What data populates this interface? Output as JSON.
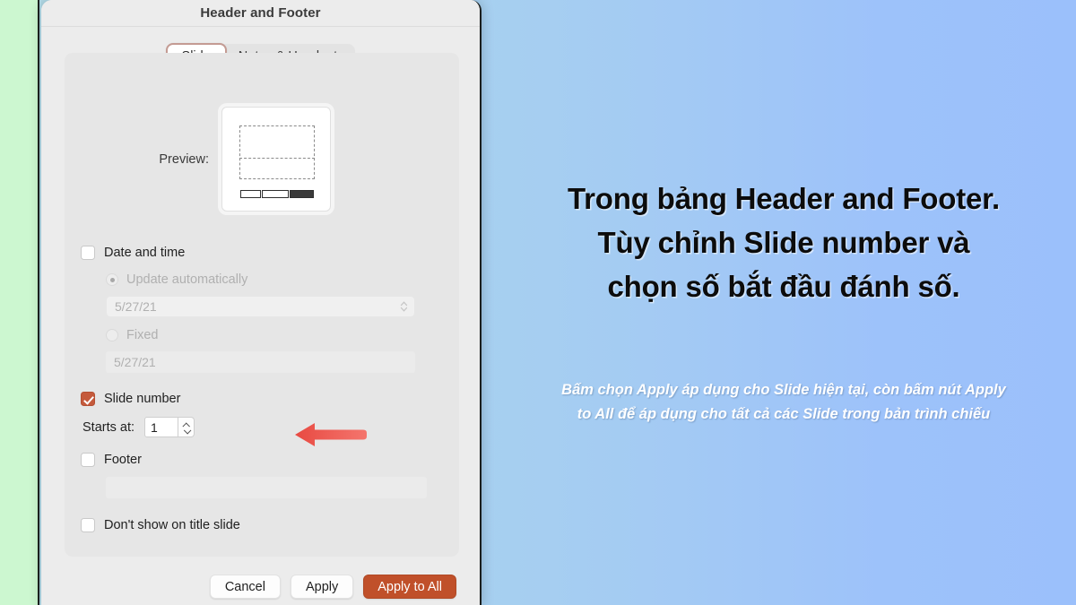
{
  "window": {
    "title": "Header and Footer"
  },
  "tabs": [
    {
      "label": "Slide",
      "active": true
    },
    {
      "label": "Notes & Handouts",
      "active": false
    }
  ],
  "preview": {
    "label": "Preview:"
  },
  "options": {
    "date_and_time": {
      "label": "Date and time",
      "checked": false,
      "update_automatically": {
        "label": "Update automatically",
        "selected": true,
        "value": "5/27/21"
      },
      "fixed": {
        "label": "Fixed",
        "selected": false,
        "value": "5/27/21"
      }
    },
    "slide_number": {
      "label": "Slide number",
      "checked": true,
      "starts_at_label": "Starts at:",
      "starts_at_value": "1"
    },
    "footer": {
      "label": "Footer",
      "checked": false,
      "value": ""
    },
    "dont_show_on_title_slide": {
      "label": "Don't show on title slide",
      "checked": false
    }
  },
  "buttons": {
    "cancel": "Cancel",
    "apply": "Apply",
    "apply_to_all": "Apply to All"
  },
  "annotation": {
    "headline_line1": "Trong bảng Header and Footer.",
    "headline_line2": "Tùy chỉnh Slide number và",
    "headline_line3": "chọn số bắt đầu đánh số.",
    "caption_line1": "Bấm chọn Apply áp dụng cho Slide hiện tại, còn bấm nút Apply",
    "caption_line2": "to All để áp dụng cho tất cả các Slide trong bản trình chiếu"
  },
  "colors": {
    "accent": "#c0502a",
    "checkbox_checked": "#c55a3c",
    "tab_active_border": "#c49b93",
    "arrow": "#ef5350",
    "left_strip": "#ccf7d0",
    "bg_gradient_start": "#b4dce8",
    "bg_gradient_end": "#9bc0fb"
  }
}
